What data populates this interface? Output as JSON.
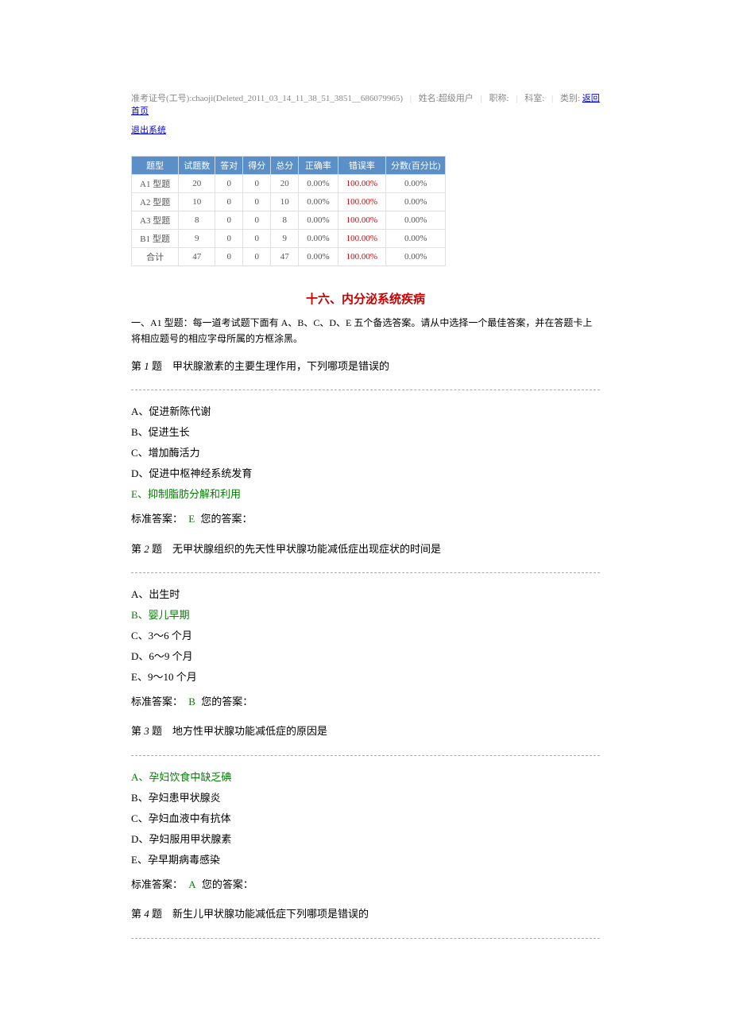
{
  "header": {
    "exam_id_label": "准考证号(工号):",
    "exam_id_value": "chaoji(Deleted_2011_03_14_11_38_51_3851__686079965)",
    "name_label": "姓名:",
    "name_value": "超级用户",
    "title_label": "职称:",
    "dept_label": "科室:",
    "category_label": "类别:",
    "home_link": "返回首页",
    "logout_link": "退出系统"
  },
  "table": {
    "headers": [
      "题型",
      "试题数",
      "答对",
      "得分",
      "总分",
      "正确率",
      "错误率",
      "分数(百分比)"
    ],
    "rows": [
      {
        "cells": [
          "A1 型题",
          "20",
          "0",
          "0",
          "20",
          "0.00%",
          "100.00%",
          "0.00%"
        ]
      },
      {
        "cells": [
          "A2 型题",
          "10",
          "0",
          "0",
          "10",
          "0.00%",
          "100.00%",
          "0.00%"
        ]
      },
      {
        "cells": [
          "A3 型题",
          "8",
          "0",
          "0",
          "8",
          "0.00%",
          "100.00%",
          "0.00%"
        ]
      },
      {
        "cells": [
          "B1 型题",
          "9",
          "0",
          "0",
          "9",
          "0.00%",
          "100.00%",
          "0.00%"
        ]
      },
      {
        "cells": [
          "合计",
          "47",
          "0",
          "0",
          "47",
          "0.00%",
          "100.00%",
          "0.00%"
        ]
      }
    ]
  },
  "title": "十六、内分泌系统疾病",
  "instructions": "一、A1 型题：每一道考试题下面有 A、B、C、D、E 五个备选答案。请从中选择一个最佳答案，并在答题卡上将相应题号的相应字母所属的方框涂黑。",
  "questions": [
    {
      "prefix": "第",
      "num": "1",
      "suffix": "题",
      "stem": "甲状腺激素的主要生理作用，下列哪项是错误的",
      "options": [
        {
          "text": "A、促进新陈代谢",
          "correct": false
        },
        {
          "text": "B、促进生长",
          "correct": false
        },
        {
          "text": "C、增加酶活力",
          "correct": false
        },
        {
          "text": "D、促进中枢神经系统发育",
          "correct": false
        },
        {
          "text": "E、抑制脂肪分解和利用",
          "correct": true
        }
      ],
      "std_label": "标准答案：",
      "std_answer": "E",
      "your_label": "您的答案："
    },
    {
      "prefix": "第",
      "num": "2",
      "suffix": "题",
      "stem": "无甲状腺组织的先天性甲状腺功能减低症出现症状的时间是",
      "options": [
        {
          "text": "A、出生时",
          "correct": false
        },
        {
          "text": "B、婴儿早期",
          "correct": true
        },
        {
          "text": "C、3～6 个月",
          "correct": false
        },
        {
          "text": "D、6～9 个月",
          "correct": false
        },
        {
          "text": "E、9～10 个月",
          "correct": false
        }
      ],
      "std_label": "标准答案：",
      "std_answer": "B",
      "your_label": "您的答案："
    },
    {
      "prefix": "第",
      "num": "3",
      "suffix": "题",
      "stem": "地方性甲状腺功能减低症的原因是",
      "options": [
        {
          "text": "A、孕妇饮食中缺乏碘",
          "correct": true
        },
        {
          "text": "B、孕妇患甲状腺炎",
          "correct": false
        },
        {
          "text": "C、孕妇血液中有抗体",
          "correct": false
        },
        {
          "text": "D、孕妇服用甲状腺素",
          "correct": false
        },
        {
          "text": "E、孕早期病毒感染",
          "correct": false
        }
      ],
      "std_label": "标准答案：",
      "std_answer": "A",
      "your_label": "您的答案："
    },
    {
      "prefix": "第",
      "num": "4",
      "suffix": "题",
      "stem": "新生儿甲状腺功能减低症下列哪项是错误的",
      "options": [],
      "std_label": "",
      "std_answer": "",
      "your_label": ""
    }
  ]
}
